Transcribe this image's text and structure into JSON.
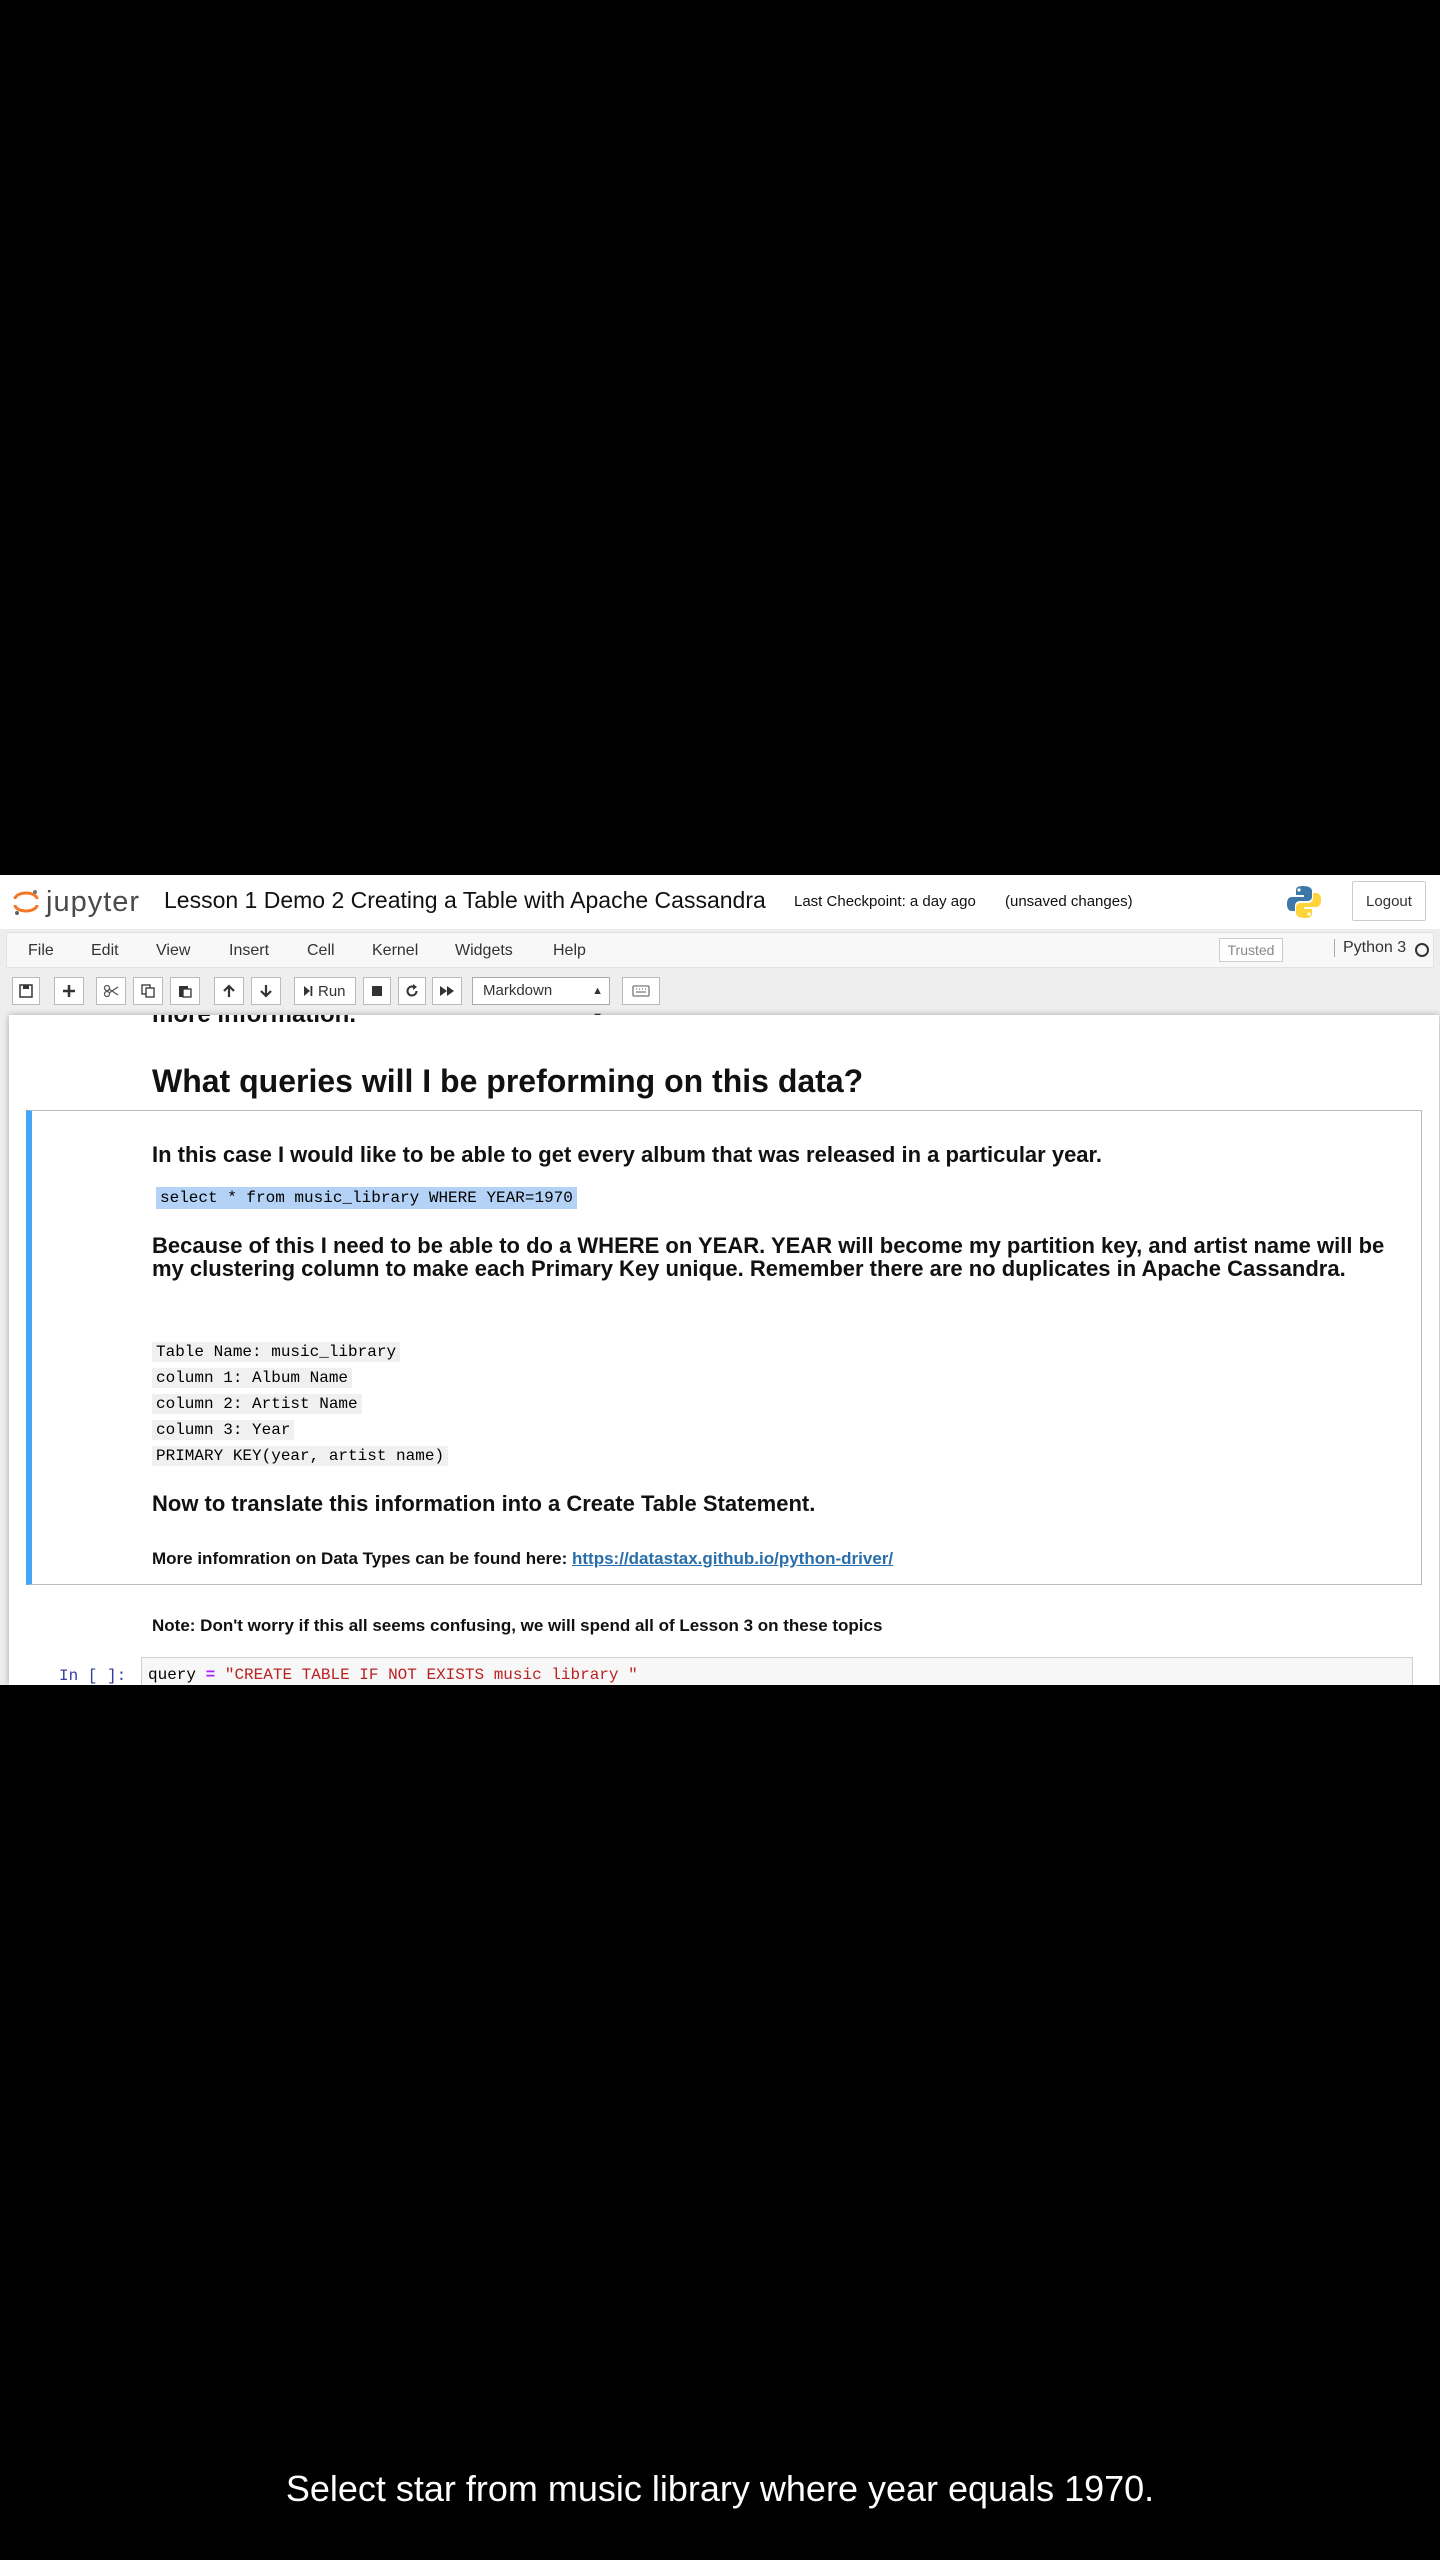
{
  "header": {
    "logo_text": "jupyter",
    "notebook_title": "Lesson 1 Demo 2 Creating a Table with Apache Cassandra",
    "checkpoint": "Last Checkpoint: a day ago",
    "unsaved": "(unsaved changes)",
    "logout_label": "Logout"
  },
  "menu": {
    "items": [
      "File",
      "Edit",
      "View",
      "Insert",
      "Cell",
      "Kernel",
      "Widgets",
      "Help"
    ],
    "trusted_label": "Trusted",
    "kernel_name": "Python 3"
  },
  "toolbar": {
    "run_label": "Run",
    "cell_type": "Markdown"
  },
  "notebook": {
    "cut_text": "more information.",
    "heading": "What queries will I be preforming on this data?",
    "intro": "In this case I would like to be able to get every album that was released in a particular year.",
    "query_code": "select * from music_library WHERE YEAR=1970",
    "explanation": "Because of this I need to be able to do a WHERE on YEAR. YEAR will become my partition key, and artist name will be my clustering column to make each Primary Key unique. Remember there are no duplicates in Apache Cassandra.",
    "table_lines": [
      "Table Name: music_library",
      "column 1: Album Name",
      "column 2: Artist Name",
      "column 3: Year",
      "PRIMARY KEY(year, artist name)"
    ],
    "translate_heading": "Now to translate this information into a Create Table Statement.",
    "datatypes_text": "More infomration on Data Types can be found here:",
    "datatypes_link": "https://datastax.github.io/python-driver/",
    "note": "Note: Don't worry if this all seems confusing, we will spend all of Lesson 3 on these topics",
    "prompt": "In [ ]:",
    "code_var": "query",
    "code_op": "=",
    "code_str": "\"CREATE TABLE IF NOT EXISTS music library \""
  },
  "caption": "Select star from music library where year equals 1970.",
  "colors": {
    "selected_border": "#42a5f5",
    "highlight": "#b3d2f5",
    "link": "#296eaa"
  }
}
